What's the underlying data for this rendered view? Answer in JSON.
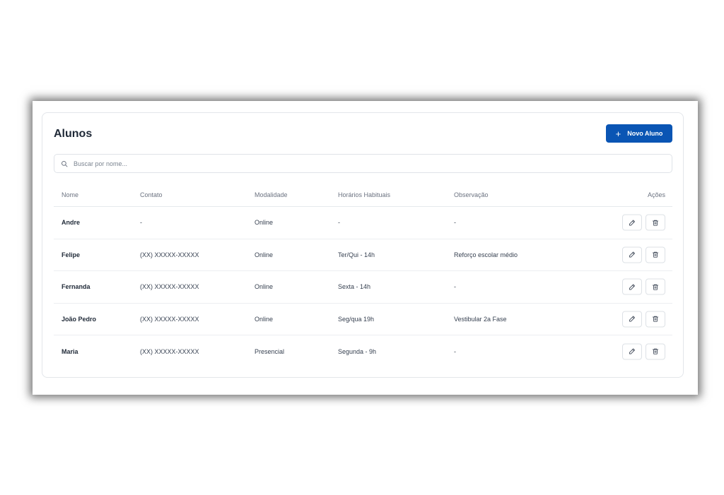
{
  "page": {
    "title": "Alunos",
    "add_button_label": "Novo Aluno",
    "add_button_icon": "plus-icon",
    "search_placeholder": "Buscar por nome..."
  },
  "colors": {
    "primary": "#0a55b4",
    "text": "#1f2937",
    "muted": "#6b7280",
    "border": "#e3e6ea"
  },
  "table": {
    "headers": [
      "Nome",
      "Contato",
      "Modalidade",
      "Horários Habituais",
      "Observação",
      "Ações"
    ],
    "rows": [
      {
        "nome": "Andre",
        "contato": "-",
        "modalidade": "Online",
        "horarios": "-",
        "observacao": "-"
      },
      {
        "nome": "Felipe",
        "contato": "(XX) XXXXX-XXXXX",
        "modalidade": "Online",
        "horarios": "Ter/Qui - 14h",
        "observacao": "Reforço escolar médio"
      },
      {
        "nome": "Fernanda",
        "contato": "(XX) XXXXX-XXXXX",
        "modalidade": "Online",
        "horarios": "Sexta - 14h",
        "observacao": "-"
      },
      {
        "nome": "João Pedro",
        "contato": "(XX) XXXXX-XXXXX",
        "modalidade": "Online",
        "horarios": "Seg/qua 19h",
        "observacao": "Vestibular 2a Fase"
      },
      {
        "nome": "Maria",
        "contato": "(XX) XXXXX-XXXXX",
        "modalidade": "Presencial",
        "horarios": "Segunda - 9h",
        "observacao": "-"
      }
    ],
    "row_action_icons": [
      "pencil-icon",
      "trash-icon"
    ]
  }
}
